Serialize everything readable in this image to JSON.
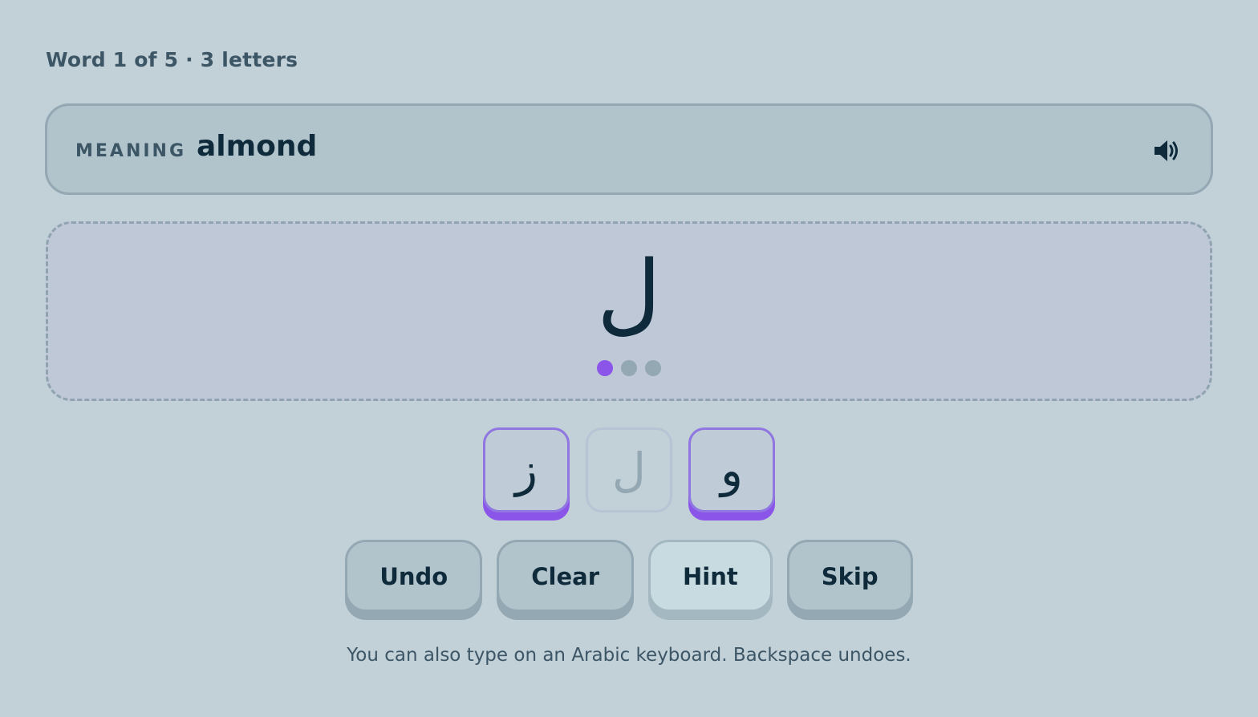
{
  "progress": {
    "label": "Word 1 of 5 · 3 letters"
  },
  "meaning": {
    "tag": "MEANING",
    "word": "almond",
    "audio_icon": "speaker-icon"
  },
  "answer": {
    "current_letter": "ل",
    "slots_total": 3,
    "slots_filled": 1
  },
  "tiles": [
    {
      "letter": "ز",
      "state": "available"
    },
    {
      "letter": "ل",
      "state": "used"
    },
    {
      "letter": "و",
      "state": "available"
    }
  ],
  "actions": {
    "undo": "Undo",
    "clear": "Clear",
    "hint": "Hint",
    "skip": "Skip"
  },
  "helper_text": "You can also type on an Arabic keyboard. Backspace undoes.",
  "colors": {
    "background": "#c2d0d8",
    "accent": "#8a55e8",
    "text": "#0f2a3a"
  }
}
